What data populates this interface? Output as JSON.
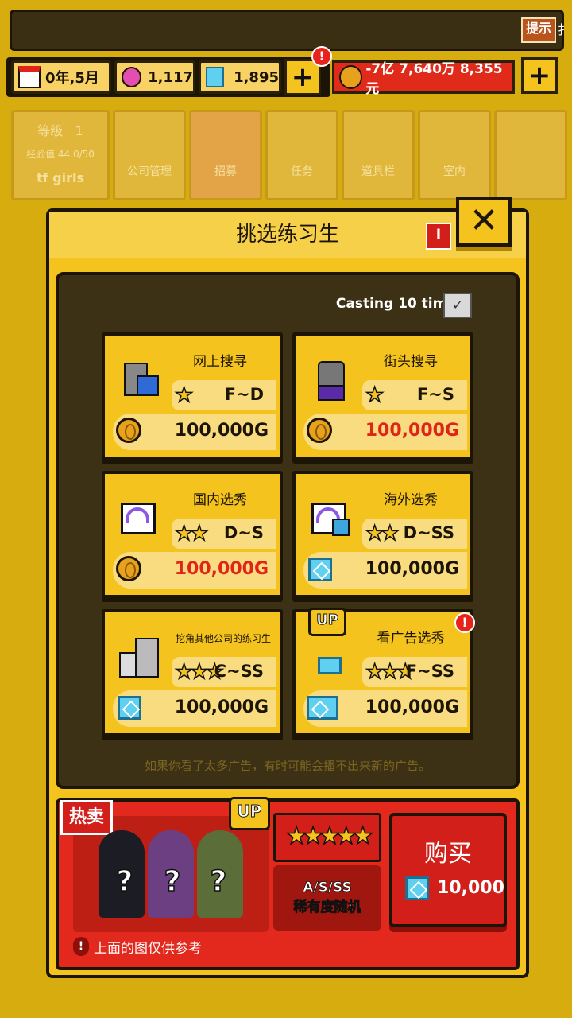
{
  "topbar": {
    "hint_label": "提示",
    "hint_extra": "扌"
  },
  "resources": {
    "date": "0年,5月",
    "pink_gems": "1,117",
    "blue_gems": "1,895",
    "money": "-7亿 7,640万 8,355元",
    "alert_mark": "!"
  },
  "background_tabs": {
    "level_label": "等级",
    "level_value": "1",
    "exp_label": "经验值 44.0/50",
    "company_name": "tf girls",
    "tabs": [
      "公司管理",
      "招募",
      "任务",
      "道具栏",
      "室内"
    ]
  },
  "modal": {
    "title": "挑选练习生",
    "info_mark": "i",
    "close_label": "✕",
    "casting_label": "Casting 10 times",
    "cards": [
      {
        "name": "网上搜寻",
        "rank": "F~D",
        "stars": "★",
        "price": "100,000G",
        "currency": "coin",
        "price_red": false
      },
      {
        "name": "街头搜寻",
        "rank": "F~S",
        "stars": "★",
        "price": "100,000G",
        "currency": "coin",
        "price_red": true
      },
      {
        "name": "国内选秀",
        "rank": "D~S",
        "stars": "★★",
        "price": "100,000G",
        "currency": "coin",
        "price_red": true
      },
      {
        "name": "海外选秀",
        "rank": "D~SS",
        "stars": "★★",
        "price": "100,000G",
        "currency": "gem",
        "price_red": false
      },
      {
        "name": "挖角其他公司的练习生",
        "rank": "C~SS",
        "stars": "★★★",
        "price": "100,000G",
        "currency": "gem",
        "price_red": false
      },
      {
        "name": "看广告选秀",
        "rank": "F~SS",
        "stars": "★★★",
        "price": "100,000G",
        "currency": "ad",
        "price_red": false
      }
    ],
    "notice": "如果你看了太多广告，有时可能会播不出来新的广告。",
    "hot_sale": {
      "label": "热卖",
      "up_badge": "UP",
      "qmarks": [
        "?",
        "?",
        "?"
      ],
      "stars": "★★★★★",
      "rarity_line1": "A/S/SS",
      "rarity_line2": "稀有度随机",
      "buy_label": "购买",
      "buy_price": "10,000",
      "disclaimer": "上面的图仅供参考"
    }
  },
  "colors": {
    "accent": "#f5c31d",
    "dark": "#1c1506",
    "red": "#e0241a",
    "gem": "#5fd0f0"
  }
}
